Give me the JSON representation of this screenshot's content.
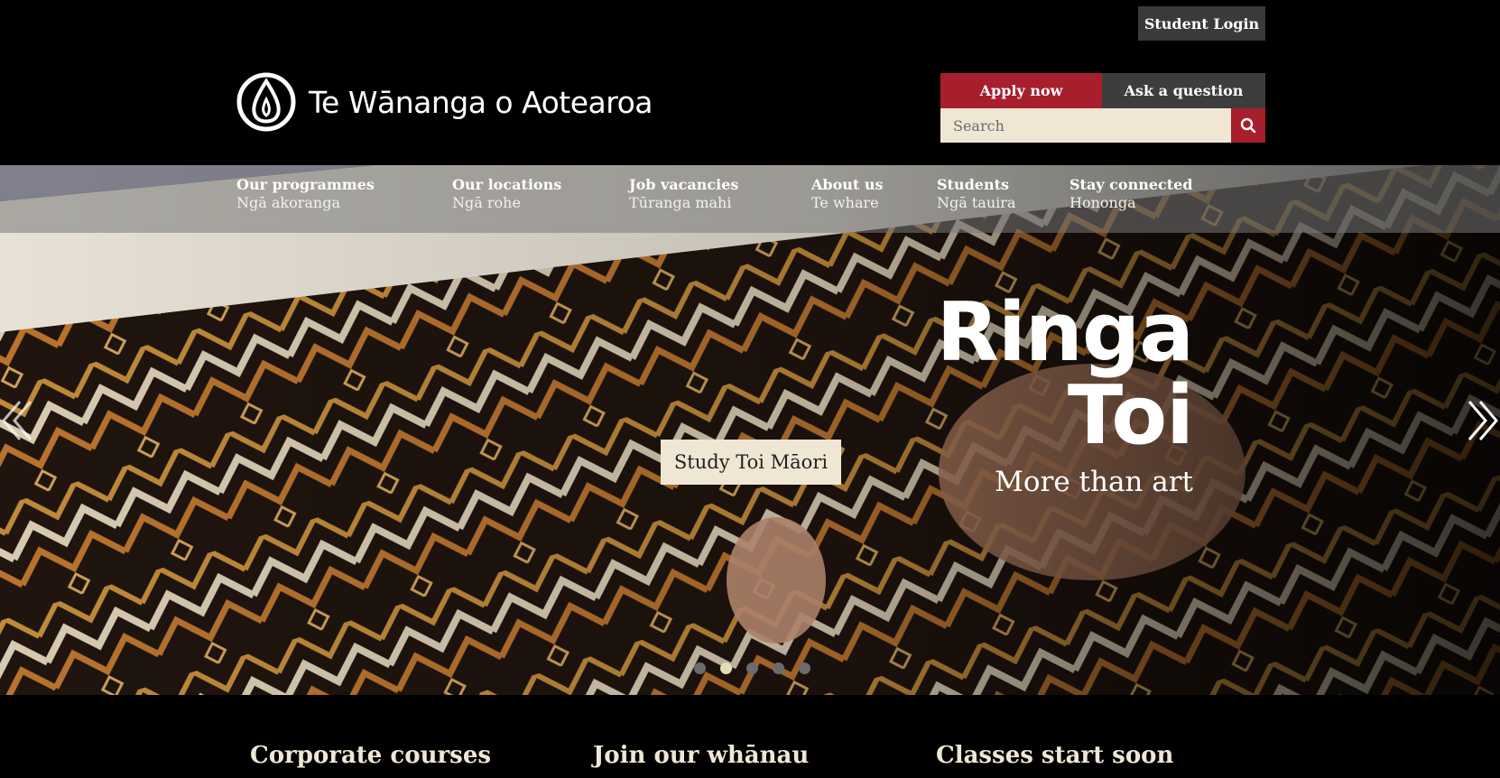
{
  "header": {
    "student_login": "Student Login",
    "logo_text": "Te Wānanga o Aotearoa",
    "apply_label": "Apply now",
    "ask_label": "Ask a question",
    "search_placeholder": "Search",
    "colors": {
      "accent": "#a71f2d",
      "dark_button": "#3d3d3d",
      "cream": "#efe7d4"
    }
  },
  "nav": {
    "items": [
      {
        "en": "Our programmes",
        "mi": "Ngā akoranga"
      },
      {
        "en": "Our locations",
        "mi": "Ngā rohe"
      },
      {
        "en": "Job vacancies",
        "mi": "Tūranga mahi"
      },
      {
        "en": "About us",
        "mi": "Te whare"
      },
      {
        "en": "Students",
        "mi": "Ngā tauira"
      },
      {
        "en": "Stay connected",
        "mi": "Hononga"
      }
    ]
  },
  "hero": {
    "headline_line1": "Ringa",
    "headline_line2": "Toi",
    "subline": "More than art",
    "cta": "Study Toi Māori",
    "prev_icon": "chevron-left-icon",
    "next_icon": "chevron-right-icon",
    "slides_total": 5,
    "active_slide": 2
  },
  "features": {
    "items": [
      "Corporate courses",
      "Join our whānau",
      "Classes start soon"
    ]
  }
}
